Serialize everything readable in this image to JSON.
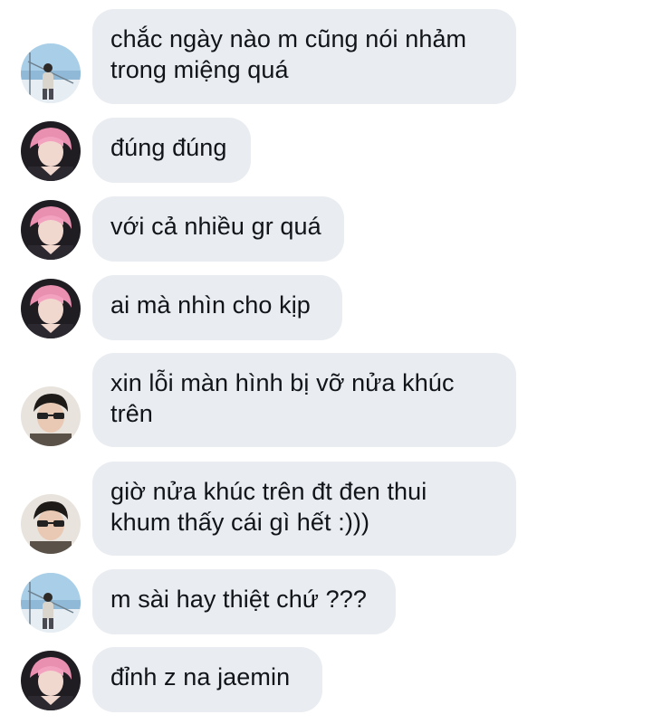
{
  "conversation": {
    "messages": [
      {
        "sender_avatar": "avatar-seaside-boy-icon",
        "text": "chắc ngày nào m cũng nói nhảm\ntrong miệng quá"
      },
      {
        "sender_avatar": "avatar-pink-hair-icon",
        "text": "đúng đúng"
      },
      {
        "sender_avatar": "avatar-pink-hair-icon",
        "text": "với cả nhiều gr quá"
      },
      {
        "sender_avatar": "avatar-pink-hair-icon",
        "text": "ai mà nhìn cho kịp"
      },
      {
        "sender_avatar": "avatar-sunglasses-icon",
        "text": "xin lỗi màn hình bị vỡ nửa khúc\ntrên"
      },
      {
        "sender_avatar": "avatar-sunglasses-icon",
        "text": "giờ nửa khúc trên đt đen thui\nkhum thấy cái gì hết :)))"
      },
      {
        "sender_avatar": "avatar-seaside-boy-icon",
        "text": "m sài hay thiệt chứ ???"
      },
      {
        "sender_avatar": "avatar-pink-hair-icon",
        "text": "đỉnh z na jaemin"
      }
    ]
  },
  "colors": {
    "bubble_background": "#e9ecf0",
    "text": "#111418",
    "page_background": "#ffffff"
  }
}
